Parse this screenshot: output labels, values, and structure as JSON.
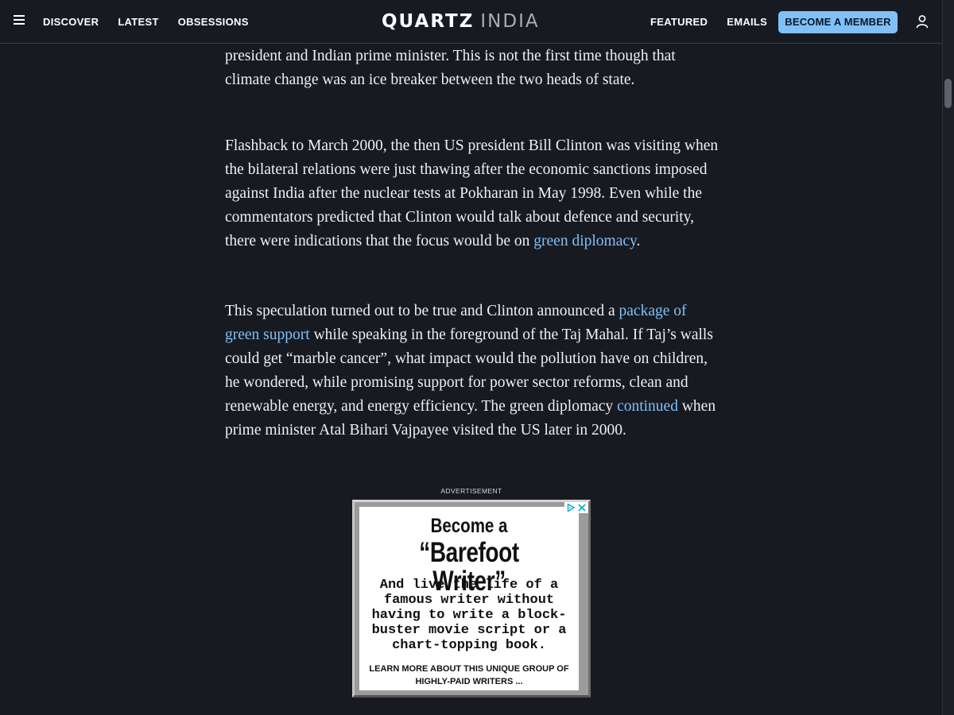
{
  "header": {
    "nav_left": [
      "DISCOVER",
      "LATEST",
      "OBSESSIONS"
    ],
    "logo": {
      "brand": "QUARTZ",
      "edition": "INDIA"
    },
    "nav_right": [
      "FEATURED",
      "EMAILS"
    ],
    "cta": "BECOME A MEMBER",
    "icons": {
      "menu": "hamburger-menu-icon",
      "account": "user-account-icon"
    }
  },
  "article": {
    "p1": {
      "text": "president and Indian prime minister. This is not the first time though that climate change was an ice breaker between the two heads of state."
    },
    "p2": {
      "before": "Flashback to March 2000, the then US president Bill Clinton was visiting when the bilateral relations were just thawing after the economic sanctions imposed against India after the nuclear tests at Pokharan in May 1998. Even while the commentators predicted that Clinton would talk about defence and security, there were indications that the focus would be on ",
      "link": "green diplomacy",
      "after": "."
    },
    "p3": {
      "before": "This speculation turned out to be true and Clinton announced a ",
      "link1": "package of green support",
      "middle": " while speaking in the foreground of the Taj Mahal. If Taj’s walls could get “marble cancer”, what impact would the pollution have on children, he wondered, while promising support for power sector reforms, clean and renewable energy, and energy efficiency. The green diplomacy ",
      "link2": "continued",
      "after": " when prime minister Atal Bihari Vajpayee visited the US later in 2000."
    }
  },
  "ad": {
    "label": "ADVERTISEMENT",
    "headline1": "Become a",
    "headline2": "“Barefoot Writer”",
    "body": "And live the life of a famous writer without having to write a block-buster movie script or a chart-topping book.",
    "cta": "LEARN MORE ABOUT THIS UNIQUE GROUP OF HIGHLY-PAID WRITERS ...",
    "icons": {
      "adchoices": "ad-choices-icon",
      "close": "close-icon"
    }
  },
  "colors": {
    "background": "#181a22",
    "text": "#f0f0f0",
    "link": "#7fc0f7",
    "cta_button": "#7fc0f7"
  }
}
